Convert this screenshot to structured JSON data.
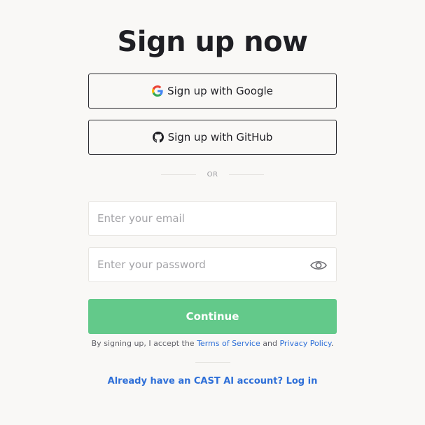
{
  "page": {
    "title": "Sign up now"
  },
  "oauth": {
    "google_label": "Sign up with Google",
    "google_icon": "google-icon",
    "github_label": "Sign up with GitHub",
    "github_icon": "github-icon"
  },
  "divider": {
    "text": "OR"
  },
  "form": {
    "email": {
      "value": "",
      "placeholder": "Enter your email"
    },
    "password": {
      "value": "",
      "placeholder": "Enter your password",
      "toggle_icon": "eye-icon"
    },
    "continue_label": "Continue"
  },
  "terms": {
    "prefix": "By signing up, I accept the ",
    "tos_label": "Terms of Service",
    "middle": " and ",
    "privacy_label": "Privacy Policy",
    "suffix": "."
  },
  "footer": {
    "login_label": "Already have an CAST AI account? Log in"
  },
  "colors": {
    "background": "#f9f8f6",
    "primary_button": "#63c98a",
    "link": "#2e6fd8",
    "text": "#1f1f24"
  }
}
